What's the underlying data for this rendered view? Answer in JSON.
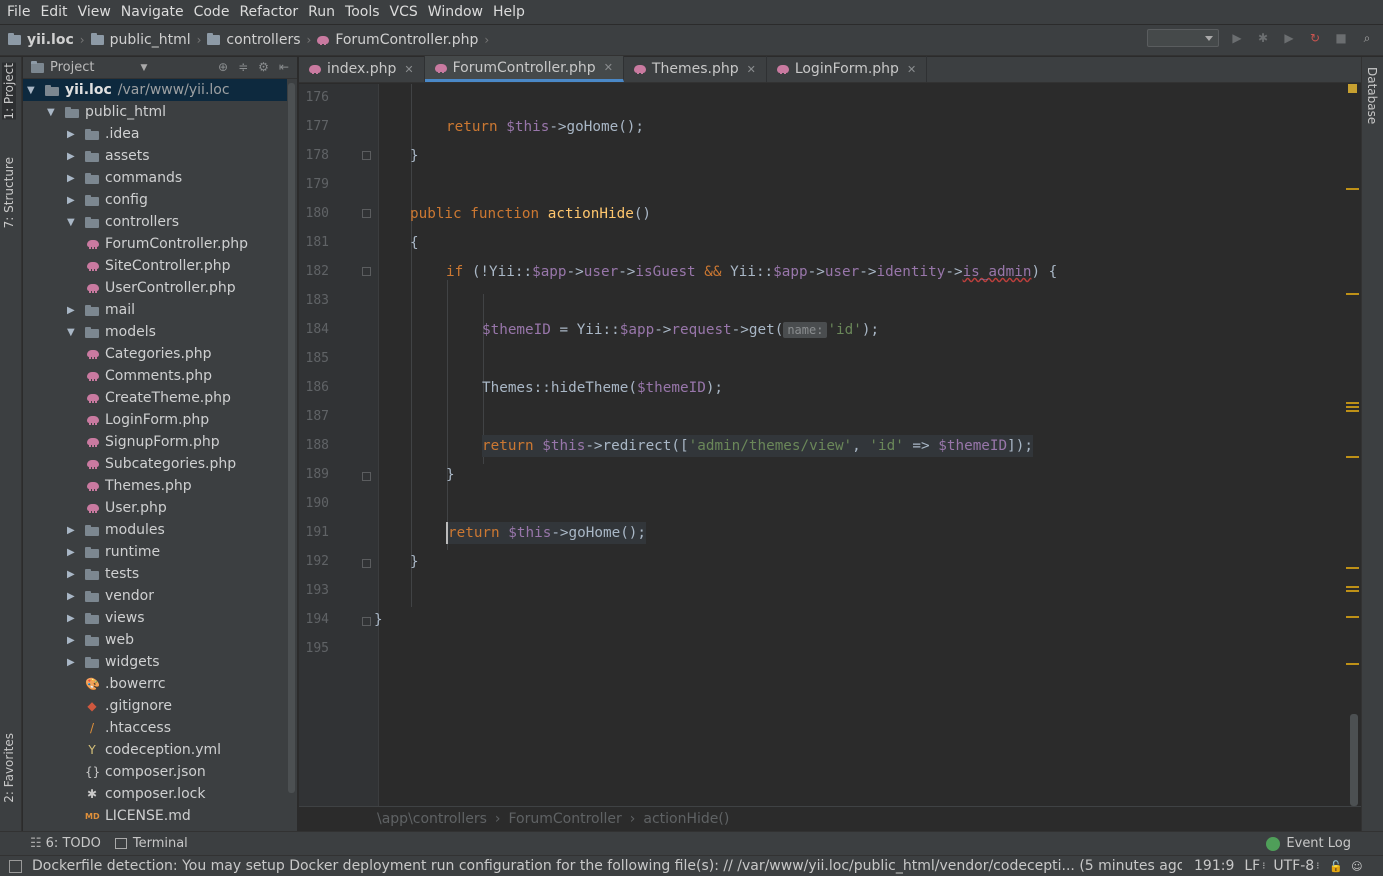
{
  "menu": [
    "File",
    "Edit",
    "View",
    "Navigate",
    "Code",
    "Refactor",
    "Run",
    "Tools",
    "VCS",
    "Window",
    "Help"
  ],
  "breadcrumbs": [
    "yii.loc",
    "public_html",
    "controllers",
    "ForumController.php"
  ],
  "left_strip": {
    "project": "1: Project",
    "structure": "7: Structure",
    "favorites": "2: Favorites"
  },
  "right_strip": {
    "database": "Database"
  },
  "project": {
    "title": "Project",
    "tree": [
      {
        "label": "yii.loc",
        "sub": "/var/www/yii.loc",
        "type": "root"
      },
      {
        "label": "public_html",
        "type": "folder"
      },
      {
        "label": ".idea",
        "type": "folder"
      },
      {
        "label": "assets",
        "type": "folder"
      },
      {
        "label": "commands",
        "type": "folder"
      },
      {
        "label": "config",
        "type": "folder"
      },
      {
        "label": "controllers",
        "type": "folder"
      },
      {
        "label": "ForumController.php",
        "type": "php"
      },
      {
        "label": "SiteController.php",
        "type": "php"
      },
      {
        "label": "UserController.php",
        "type": "php"
      },
      {
        "label": "mail",
        "type": "folder"
      },
      {
        "label": "models",
        "type": "folder"
      },
      {
        "label": "Categories.php",
        "type": "php"
      },
      {
        "label": "Comments.php",
        "type": "php"
      },
      {
        "label": "CreateTheme.php",
        "type": "php"
      },
      {
        "label": "LoginForm.php",
        "type": "php"
      },
      {
        "label": "SignupForm.php",
        "type": "php"
      },
      {
        "label": "Subcategories.php",
        "type": "php"
      },
      {
        "label": "Themes.php",
        "type": "php"
      },
      {
        "label": "User.php",
        "type": "php"
      },
      {
        "label": "modules",
        "type": "folder"
      },
      {
        "label": "runtime",
        "type": "folder"
      },
      {
        "label": "tests",
        "type": "folder"
      },
      {
        "label": "vendor",
        "type": "folder"
      },
      {
        "label": "views",
        "type": "folder"
      },
      {
        "label": "web",
        "type": "folder"
      },
      {
        "label": "widgets",
        "type": "folder"
      },
      {
        "label": ".bowerrc",
        "type": "file"
      },
      {
        "label": ".gitignore",
        "type": "file"
      },
      {
        "label": ".htaccess",
        "type": "file"
      },
      {
        "label": "codeception.yml",
        "type": "file"
      },
      {
        "label": "composer.json",
        "type": "file"
      },
      {
        "label": "composer.lock",
        "type": "file"
      },
      {
        "label": "LICENSE.md",
        "type": "file"
      }
    ]
  },
  "tabs": [
    {
      "label": "index.php"
    },
    {
      "label": "ForumController.php"
    },
    {
      "label": "Themes.php"
    },
    {
      "label": "LoginForm.php"
    }
  ],
  "editor": {
    "line_numbers": [
      "176",
      "177",
      "178",
      "179",
      "180",
      "181",
      "182",
      "183",
      "184",
      "185",
      "186",
      "187",
      "188",
      "189",
      "190",
      "191",
      "192",
      "193",
      "194",
      "195"
    ],
    "param_hint": "name:",
    "breadcrumb": [
      "\\app\\controllers",
      "ForumController",
      "actionHide()"
    ]
  },
  "bottom_tools": {
    "todo": "6: TODO",
    "terminal": "Terminal",
    "event_log": "Event Log"
  },
  "status": {
    "message": "Dockerfile detection: You may setup Docker deployment run configuration for the following file(s): // /var/www/yii.loc/public_html/vendor/codecepti... (5 minutes ago)",
    "position": "191:9",
    "line_sep": "LF",
    "encoding": "UTF-8"
  },
  "colors": {
    "keyword": "#cc7832",
    "variable": "#9876aa",
    "string": "#6a8759",
    "function": "#ffc66d",
    "accent": "#4a88c7"
  }
}
